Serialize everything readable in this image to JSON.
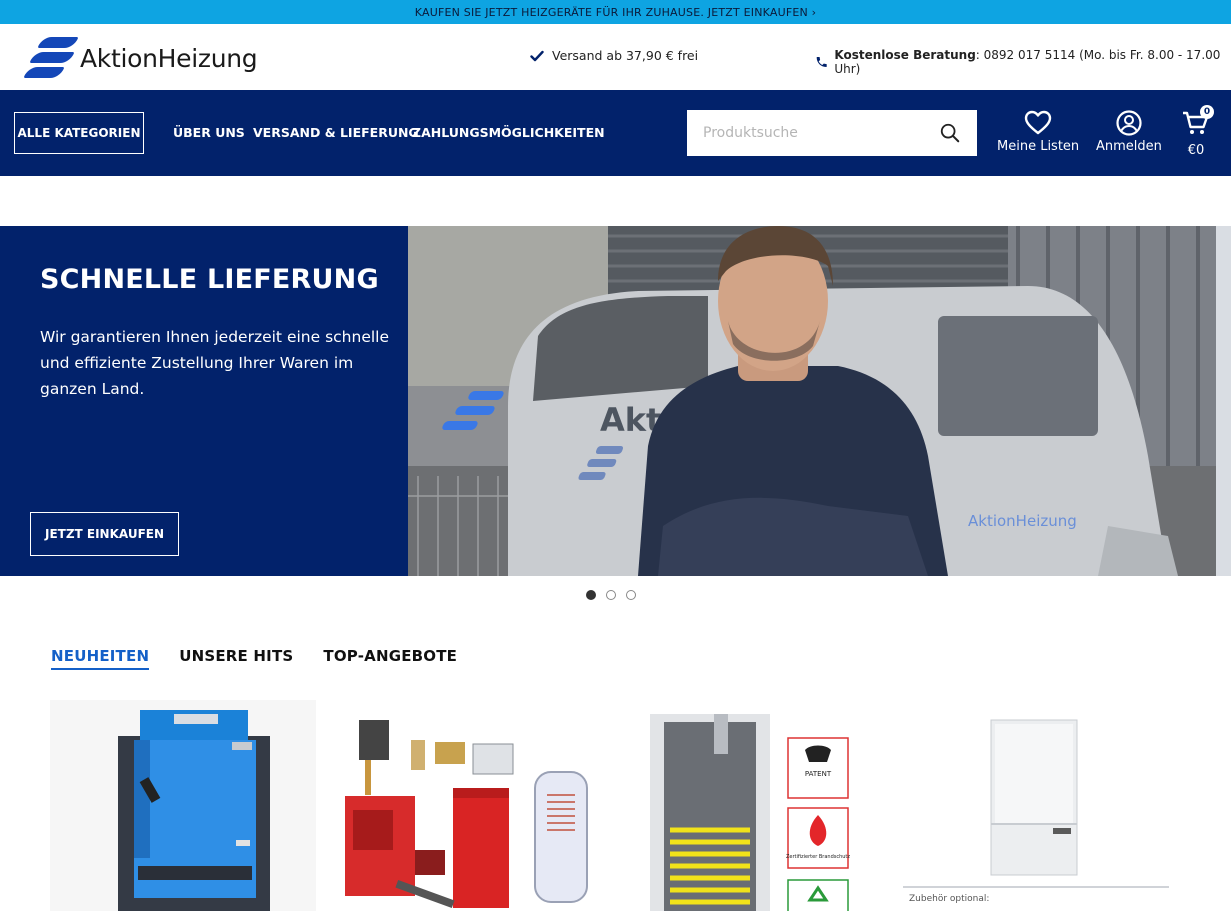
{
  "promo": {
    "text": "KAUFEN SIE JETZT HEIZGERÄTE FÜR IHR ZUHAUSE. JETZT EINKAUFEN ›"
  },
  "header": {
    "logo_text": "AktionHeizung",
    "shipping": "Versand ab 37,90 € frei",
    "consult_label": "Kostenlose Beratung",
    "consult_detail": ": 0892 017 5114 (Mo. bis Fr. 8.00 - 17.00 Uhr)"
  },
  "nav": {
    "all_categories": "ALLE KATEGORIEN",
    "links": [
      "ÜBER UNS",
      "VERSAND & LIEFERUNG",
      "ZAHLUNGSMÖGLICHKEITEN"
    ],
    "search_placeholder": "Produktsuche",
    "lists_label": "Meine Listen",
    "login_label": "Anmelden",
    "cart_label": "€0",
    "cart_count": "0"
  },
  "hero": {
    "title": "SCHNELLE LIEFERUNG",
    "text": "Wir garantieren Ihnen jederzeit eine schnelle und effiziente Zustellung Ihrer Waren im ganzen Land.",
    "button": "JETZT EINKAUFEN",
    "van_text": "AktionHeizung",
    "van_text_short": "Akt",
    "slide_count": 3,
    "active_slide": 1
  },
  "tabs": [
    {
      "label": "NEUHEITEN",
      "active": true
    },
    {
      "label": "UNSERE HITS",
      "active": false
    },
    {
      "label": "TOP-ANGEBOTE",
      "active": false
    }
  ],
  "products": {
    "badge_patent": "PATENT",
    "badge_fire": "Zertifizierter Brandschutz",
    "accessory_note": "Zubehör optional:"
  },
  "colors": {
    "navy": "#02226b",
    "promo": "#0ea4e2",
    "accent": "#1460c8",
    "brand": "#1447b8"
  }
}
